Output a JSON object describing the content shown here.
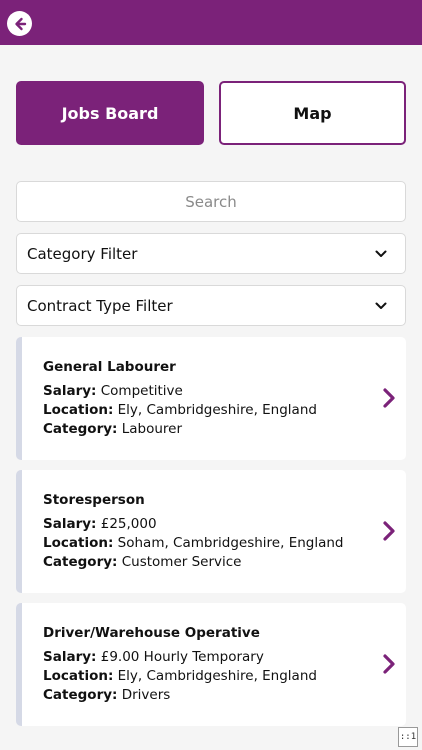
{
  "header": {
    "back_icon": "arrow-left-circle-icon"
  },
  "tabs": [
    {
      "label": "Jobs Board",
      "active": true
    },
    {
      "label": "Map",
      "active": false
    }
  ],
  "search": {
    "placeholder": "Search",
    "value": ""
  },
  "filters": {
    "category": "Category Filter",
    "contract_type": "Contract Type Filter"
  },
  "labels": {
    "salary": "Salary:",
    "location": "Location:",
    "category": "Category:"
  },
  "jobs": [
    {
      "title": "General Labourer",
      "salary": "Competitive",
      "location": "Ely, Cambridgeshire, England",
      "category": "Labourer"
    },
    {
      "title": "Storesperson",
      "salary": "£25,000",
      "location": "Soham, Cambridgeshire, England",
      "category": "Customer Service"
    },
    {
      "title": "Driver/Warehouse Operative",
      "salary": "£9.00 Hourly Temporary",
      "location": "Ely, Cambridgeshire, England",
      "category": "Drivers"
    }
  ],
  "corner_badge": "::1",
  "colors": {
    "brand": "#7b2279",
    "card_accent": "#d5d9e6",
    "background": "#f5f5f5"
  }
}
